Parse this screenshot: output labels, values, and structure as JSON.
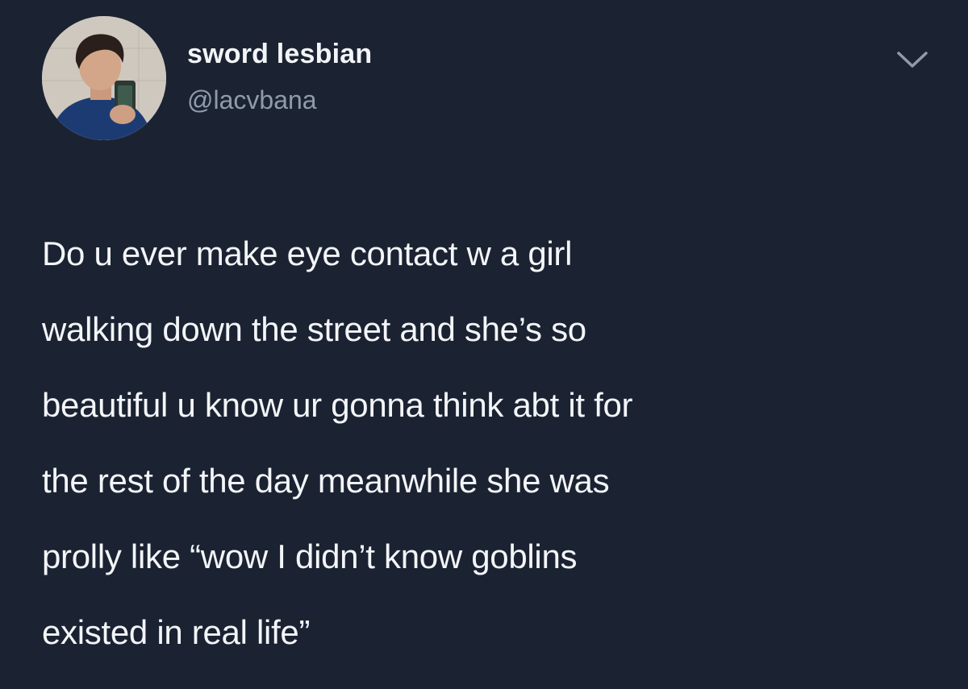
{
  "tweet": {
    "display_name": "sword lesbian",
    "handle": "@lacvbana",
    "text": "Do u ever make eye contact w a girl\nwalking down the street and she’s so\nbeautiful u know ur gonna think abt it for\nthe rest of the day meanwhile she was\nprolly like “wow I didn’t know goblins\nexisted in real life”"
  },
  "icons": {
    "menu": "chevron-down-icon",
    "avatar": "avatar"
  },
  "colors": {
    "background": "#1b2332",
    "primary_text": "#f3f5f8",
    "secondary_text": "#8f9bab"
  }
}
